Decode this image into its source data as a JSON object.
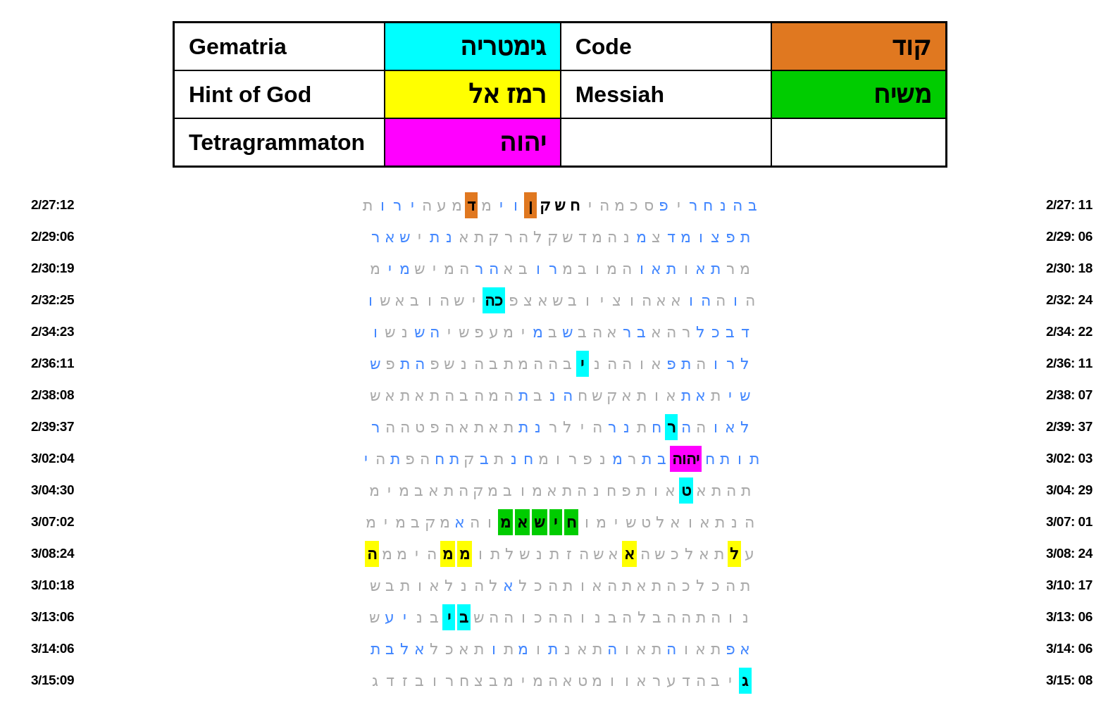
{
  "table": {
    "rows": [
      {
        "col1_label": "Gematria",
        "col1_hebrew": "גימטריה",
        "col1_hebrew_bg": "cyan",
        "col2_label": "Code",
        "col2_hebrew": "קוד",
        "col2_hebrew_bg": "orange"
      },
      {
        "col1_label": "Hint of God",
        "col1_hebrew": "רמז אל",
        "col1_hebrew_bg": "yellow",
        "col2_label": "Messiah",
        "col2_hebrew": "משיח",
        "col2_hebrew_bg": "green"
      },
      {
        "col1_label": "Tetragrammaton",
        "col1_hebrew": "יהוה",
        "col1_hebrew_bg": "magenta",
        "col2_label": "",
        "col2_hebrew": "",
        "col2_hebrew_bg": ""
      }
    ]
  },
  "grid": {
    "rows": [
      {
        "left_label": "2/27:12",
        "right_label": "2/27: 11"
      },
      {
        "left_label": "2/29:06",
        "right_label": "2/29: 06"
      },
      {
        "left_label": "2/30:19",
        "right_label": "2/30: 18"
      },
      {
        "left_label": "2/32:25",
        "right_label": "2/32: 24"
      },
      {
        "left_label": "2/34:23",
        "right_label": "2/34: 22"
      },
      {
        "left_label": "2/36:11",
        "right_label": "2/36: 11"
      },
      {
        "left_label": "2/38:08",
        "right_label": "2/38: 07"
      },
      {
        "left_label": "2/39:37",
        "right_label": "2/39: 37"
      },
      {
        "left_label": "3/02:04",
        "right_label": "3/02: 03"
      },
      {
        "left_label": "3/04:30",
        "right_label": "3/04: 29"
      },
      {
        "left_label": "3/07:02",
        "right_label": "3/07: 01"
      },
      {
        "left_label": "3/08:24",
        "right_label": "3/08: 24"
      },
      {
        "left_label": "3/10:18",
        "right_label": "3/10: 17"
      },
      {
        "left_label": "3/13:06",
        "right_label": "3/13: 06"
      },
      {
        "left_label": "3/14:06",
        "right_label": "3/14: 06"
      },
      {
        "left_label": "3/15:09",
        "right_label": "3/15: 08"
      }
    ]
  }
}
